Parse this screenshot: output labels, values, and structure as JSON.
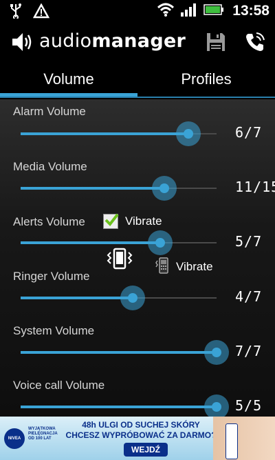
{
  "status_bar": {
    "time": "13:58"
  },
  "app_bar": {
    "title_light": "audio",
    "title_bold": "manager"
  },
  "tabs": [
    {
      "label": "Volume"
    },
    {
      "label": "Profiles"
    }
  ],
  "sliders": [
    {
      "label": "Alarm Volume",
      "value_text": "6/7",
      "level": 0.857
    },
    {
      "label": "Media Volume",
      "value_text": "11/15",
      "level": 0.733
    },
    {
      "label": "Alerts Volume",
      "value_text": "5/7",
      "level": 0.714
    },
    {
      "label": "Ringer Volume",
      "value_text": "4/7",
      "level": 0.571
    },
    {
      "label": "System Volume",
      "value_text": "7/7",
      "level": 1.0
    },
    {
      "label": "Voice call Volume",
      "value_text": "5/5",
      "level": 1.0
    }
  ],
  "alerts_vibrate": {
    "label": "Vibrate",
    "checked": true
  },
  "ringer_vibrate": {
    "label": "Vibrate"
  },
  "ad": {
    "brand": "NIVEA",
    "small_text": "WYJĄTKOWA PIELĘGNACJA OD 100 LAT",
    "line1": "48h ULGI OD SUCHEJ SKÓRY",
    "line2": "CHCESZ WYPRÓBOWAĆ ZA DARMO?",
    "button": "WEJDŹ"
  },
  "colors": {
    "accent": "#3aa3d6",
    "background": "#1e1e1e"
  }
}
